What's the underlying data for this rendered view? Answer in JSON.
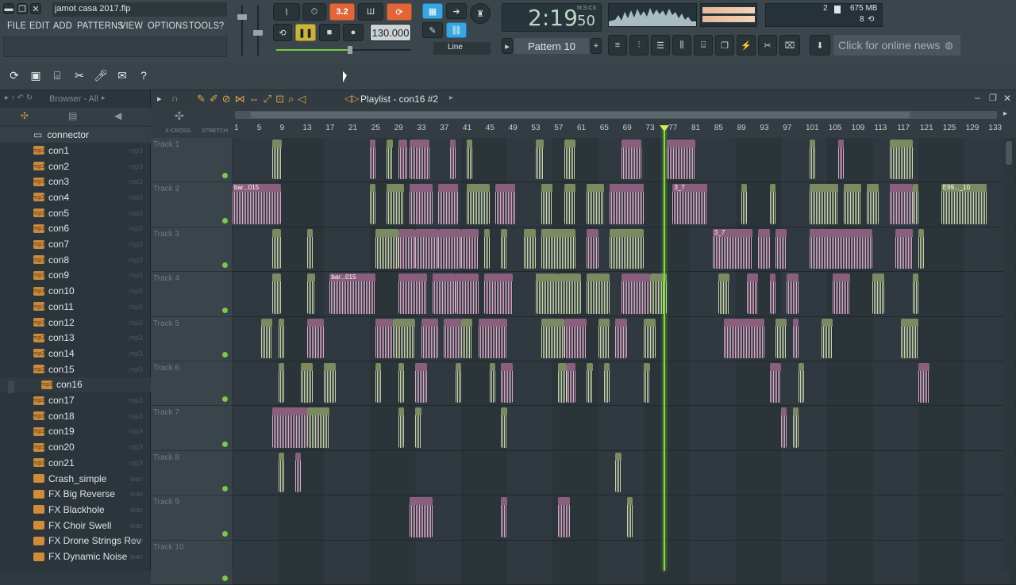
{
  "window": {
    "title": "jamot casa 2017.flp"
  },
  "menu": [
    "FILE",
    "EDIT",
    "ADD",
    "PATTERNS",
    "VIEW",
    "OPTIONS",
    "TOOLS",
    "?"
  ],
  "transport": {
    "time": "2:19",
    "time_sub": "50",
    "time_unit": "M:S:CS",
    "tempo": "130.000",
    "song_mode": "3.2",
    "snap": "Line",
    "pattern": "Pattern 10"
  },
  "stats": {
    "memory": "675 MB",
    "cpu_value": "2",
    "polyphony": "8"
  },
  "news": {
    "label": "Click for online news"
  },
  "browser": {
    "header": "Browser - All",
    "folder": "connector",
    "items": [
      {
        "name": "con1",
        "ext": "mp3"
      },
      {
        "name": "con2",
        "ext": "mp3"
      },
      {
        "name": "con3",
        "ext": "mp3"
      },
      {
        "name": "con4",
        "ext": "mp3"
      },
      {
        "name": "con5",
        "ext": "mp3"
      },
      {
        "name": "con6",
        "ext": "mp3"
      },
      {
        "name": "con7",
        "ext": "mp3"
      },
      {
        "name": "con8",
        "ext": "mp3"
      },
      {
        "name": "con9",
        "ext": "mp3"
      },
      {
        "name": "con10",
        "ext": "mp3"
      },
      {
        "name": "con11",
        "ext": "mp3"
      },
      {
        "name": "con12",
        "ext": "mp3"
      },
      {
        "name": "con13",
        "ext": "mp3"
      },
      {
        "name": "con14",
        "ext": "mp3"
      },
      {
        "name": "con15",
        "ext": "mp3"
      },
      {
        "name": "con16",
        "ext": ""
      },
      {
        "name": "con17",
        "ext": "mp3"
      },
      {
        "name": "con18",
        "ext": "mp3"
      },
      {
        "name": "con19",
        "ext": "mp3"
      },
      {
        "name": "con20",
        "ext": "mp3"
      },
      {
        "name": "con21",
        "ext": "mp3"
      },
      {
        "name": "Crash_simple",
        "ext": "wav"
      },
      {
        "name": "FX Big Reverse",
        "ext": "wav"
      },
      {
        "name": "FX Blackhole",
        "ext": "wav"
      },
      {
        "name": "FX Choir Swell",
        "ext": "wav"
      },
      {
        "name": "FX Drone Strings Rev",
        "ext": "wav"
      },
      {
        "name": "FX Dynamic Noise",
        "ext": "wav"
      }
    ]
  },
  "playlist": {
    "title": "Playlist - con16 #2",
    "ruler_ticks": [
      "1",
      "5",
      "9",
      "13",
      "17",
      "21",
      "25",
      "29",
      "33",
      "37",
      "41",
      "45",
      "49",
      "53",
      "57",
      "61",
      "65",
      "69",
      "73",
      "77",
      "81",
      "85",
      "89",
      "93",
      "97",
      "101",
      "105",
      "109",
      "113",
      "117",
      "121",
      "125",
      "129",
      "133"
    ],
    "xcross_label": "X-CROSS",
    "stretch_label": "STRETCH",
    "tracks": [
      {
        "name": "Track 1",
        "clips": [
          {
            "s": 8,
            "e": 9.6,
            "c": "g"
          },
          {
            "s": 25,
            "e": 26,
            "c": "p"
          },
          {
            "s": 28,
            "e": 29,
            "c": "g"
          },
          {
            "s": 30,
            "e": 31.5,
            "c": "p"
          },
          {
            "s": 32,
            "e": 35.5,
            "c": "p"
          },
          {
            "s": 39,
            "e": 40,
            "c": "p"
          },
          {
            "s": 42,
            "e": 43,
            "c": "g"
          },
          {
            "s": 54,
            "e": 55.5,
            "c": "g"
          },
          {
            "s": 59,
            "e": 61,
            "c": "g"
          },
          {
            "s": 69,
            "e": 72.5,
            "c": "p"
          },
          {
            "s": 77,
            "e": 82,
            "c": "p"
          },
          {
            "s": 102,
            "e": 103,
            "c": "g"
          },
          {
            "s": 107,
            "e": 108,
            "c": "p"
          },
          {
            "s": 116,
            "e": 120,
            "c": "g"
          }
        ]
      },
      {
        "name": "Track 2",
        "clips": [
          {
            "s": 1,
            "e": 9.5,
            "c": "p",
            "label": "bar...015"
          },
          {
            "s": 25,
            "e": 26,
            "c": "g"
          },
          {
            "s": 28,
            "e": 31,
            "c": "g"
          },
          {
            "s": 32,
            "e": 36,
            "c": "p"
          },
          {
            "s": 37,
            "e": 40.5,
            "c": "p"
          },
          {
            "s": 42,
            "e": 46,
            "c": "g"
          },
          {
            "s": 47,
            "e": 50.5,
            "c": "p"
          },
          {
            "s": 55,
            "e": 57,
            "c": "g"
          },
          {
            "s": 59,
            "e": 61,
            "c": "g"
          },
          {
            "s": 63,
            "e": 66,
            "c": "g"
          },
          {
            "s": 67,
            "e": 73,
            "c": "p"
          },
          {
            "s": 78,
            "e": 84,
            "c": "p",
            "label": "3_7"
          },
          {
            "s": 90,
            "e": 91,
            "c": "g"
          },
          {
            "s": 95,
            "e": 96,
            "c": "g"
          },
          {
            "s": 102,
            "e": 107,
            "c": "g"
          },
          {
            "s": 108,
            "e": 111,
            "c": "g"
          },
          {
            "s": 112,
            "e": 114,
            "c": "g"
          },
          {
            "s": 116,
            "e": 120,
            "c": "p"
          },
          {
            "s": 120,
            "e": 121,
            "c": "g"
          },
          {
            "s": 125,
            "e": 133,
            "c": "g",
            "label": "E99..._10"
          }
        ]
      },
      {
        "name": "Track 3",
        "clips": [
          {
            "s": 8,
            "e": 9.5,
            "c": "g"
          },
          {
            "s": 14,
            "e": 15,
            "c": "g"
          },
          {
            "s": 26,
            "e": 30,
            "c": "g"
          },
          {
            "s": 30,
            "e": 33,
            "c": "p"
          },
          {
            "s": 33,
            "e": 37,
            "c": "p"
          },
          {
            "s": 37,
            "e": 41,
            "c": "p"
          },
          {
            "s": 41,
            "e": 44,
            "c": "p"
          },
          {
            "s": 45,
            "e": 46,
            "c": "g"
          },
          {
            "s": 48,
            "e": 49,
            "c": "g"
          },
          {
            "s": 52,
            "e": 54,
            "c": "g"
          },
          {
            "s": 55,
            "e": 61,
            "c": "g"
          },
          {
            "s": 63,
            "e": 65,
            "c": "p"
          },
          {
            "s": 67,
            "e": 73,
            "c": "g"
          },
          {
            "s": 85,
            "e": 92,
            "c": "p",
            "label": "3_7"
          },
          {
            "s": 93,
            "e": 95,
            "c": "p"
          },
          {
            "s": 96,
            "e": 98,
            "c": "p"
          },
          {
            "s": 102,
            "e": 113,
            "c": "p"
          },
          {
            "s": 117,
            "e": 120,
            "c": "p"
          },
          {
            "s": 121,
            "e": 122,
            "c": "g"
          }
        ]
      },
      {
        "name": "Track 4",
        "clips": [
          {
            "s": 8,
            "e": 9.5,
            "c": "g"
          },
          {
            "s": 14,
            "e": 15.5,
            "c": "g"
          },
          {
            "s": 18,
            "e": 26,
            "c": "p",
            "label": "bar...015"
          },
          {
            "s": 30,
            "e": 35,
            "c": "p"
          },
          {
            "s": 36,
            "e": 40,
            "c": "p"
          },
          {
            "s": 40,
            "e": 44,
            "c": "p"
          },
          {
            "s": 45,
            "e": 50,
            "c": "p"
          },
          {
            "s": 54,
            "e": 58,
            "c": "g"
          },
          {
            "s": 58,
            "e": 62,
            "c": "g"
          },
          {
            "s": 63,
            "e": 67,
            "c": "g"
          },
          {
            "s": 69,
            "e": 74,
            "c": "p"
          },
          {
            "s": 74,
            "e": 77,
            "c": "g"
          },
          {
            "s": 86,
            "e": 88,
            "c": "g"
          },
          {
            "s": 91,
            "e": 93,
            "c": "p"
          },
          {
            "s": 95,
            "e": 96,
            "c": "p"
          },
          {
            "s": 98,
            "e": 100,
            "c": "p"
          },
          {
            "s": 106,
            "e": 109,
            "c": "p"
          },
          {
            "s": 113,
            "e": 115,
            "c": "g"
          },
          {
            "s": 120,
            "e": 121,
            "c": "g"
          }
        ]
      },
      {
        "name": "Track 5",
        "clips": [
          {
            "s": 6,
            "e": 8,
            "c": "g"
          },
          {
            "s": 9,
            "e": 10,
            "c": "g"
          },
          {
            "s": 14,
            "e": 17,
            "c": "p"
          },
          {
            "s": 26,
            "e": 29,
            "c": "p"
          },
          {
            "s": 29,
            "e": 33,
            "c": "g"
          },
          {
            "s": 34,
            "e": 37,
            "c": "p"
          },
          {
            "s": 38,
            "e": 41,
            "c": "p"
          },
          {
            "s": 41,
            "e": 43,
            "c": "g"
          },
          {
            "s": 44,
            "e": 49,
            "c": "p"
          },
          {
            "s": 55,
            "e": 59,
            "c": "g"
          },
          {
            "s": 59,
            "e": 63,
            "c": "p"
          },
          {
            "s": 65,
            "e": 67,
            "c": "g"
          },
          {
            "s": 68,
            "e": 70,
            "c": "p"
          },
          {
            "s": 73,
            "e": 75,
            "c": "g"
          },
          {
            "s": 87,
            "e": 94,
            "c": "p"
          },
          {
            "s": 96,
            "e": 98,
            "c": "g"
          },
          {
            "s": 99,
            "e": 100,
            "c": "p"
          },
          {
            "s": 104,
            "e": 106,
            "c": "g"
          },
          {
            "s": 118,
            "e": 121,
            "c": "g"
          }
        ]
      },
      {
        "name": "Track 6",
        "clips": [
          {
            "s": 9,
            "e": 10,
            "c": "g"
          },
          {
            "s": 13,
            "e": 15,
            "c": "g"
          },
          {
            "s": 17,
            "e": 19,
            "c": "g"
          },
          {
            "s": 26,
            "e": 27,
            "c": "g"
          },
          {
            "s": 30,
            "e": 31,
            "c": "g"
          },
          {
            "s": 33,
            "e": 35,
            "c": "p"
          },
          {
            "s": 40,
            "e": 41,
            "c": "g"
          },
          {
            "s": 46,
            "e": 47,
            "c": "g"
          },
          {
            "s": 48,
            "e": 50,
            "c": "p"
          },
          {
            "s": 58,
            "e": 59.5,
            "c": "g"
          },
          {
            "s": 59.5,
            "e": 61,
            "c": "p"
          },
          {
            "s": 63,
            "e": 64,
            "c": "g"
          },
          {
            "s": 66,
            "e": 67,
            "c": "g"
          },
          {
            "s": 73,
            "e": 74,
            "c": "g"
          },
          {
            "s": 95,
            "e": 97,
            "c": "p"
          },
          {
            "s": 100,
            "e": 101,
            "c": "g"
          },
          {
            "s": 121,
            "e": 123,
            "c": "p"
          }
        ]
      },
      {
        "name": "Track 7",
        "clips": [
          {
            "s": 8,
            "e": 14,
            "c": "p"
          },
          {
            "s": 14,
            "e": 18,
            "c": "g"
          },
          {
            "s": 30,
            "e": 31,
            "c": "g"
          },
          {
            "s": 33,
            "e": 34,
            "c": "g"
          },
          {
            "s": 48,
            "e": 49,
            "c": "g"
          },
          {
            "s": 97,
            "e": 98,
            "c": "p"
          },
          {
            "s": 99,
            "e": 100,
            "c": "g"
          }
        ]
      },
      {
        "name": "Track 8",
        "clips": [
          {
            "s": 9,
            "e": 10,
            "c": "g"
          },
          {
            "s": 12,
            "e": 13,
            "c": "p"
          },
          {
            "s": 68,
            "e": 69,
            "c": "g"
          }
        ]
      },
      {
        "name": "Track 9",
        "clips": [
          {
            "s": 32,
            "e": 36,
            "c": "p"
          },
          {
            "s": 48,
            "e": 49,
            "c": "p"
          },
          {
            "s": 58,
            "e": 60,
            "c": "p"
          },
          {
            "s": 70,
            "e": 71,
            "c": "g"
          }
        ]
      },
      {
        "name": "Track 10",
        "clips": []
      }
    ]
  },
  "colors": {
    "clip_pink": "#d9a9c9",
    "clip_green": "#c9d4ad",
    "playhead": "#7bdc3a",
    "accent_orange": "#e0673a",
    "accent_blue": "#3aa6e0"
  }
}
